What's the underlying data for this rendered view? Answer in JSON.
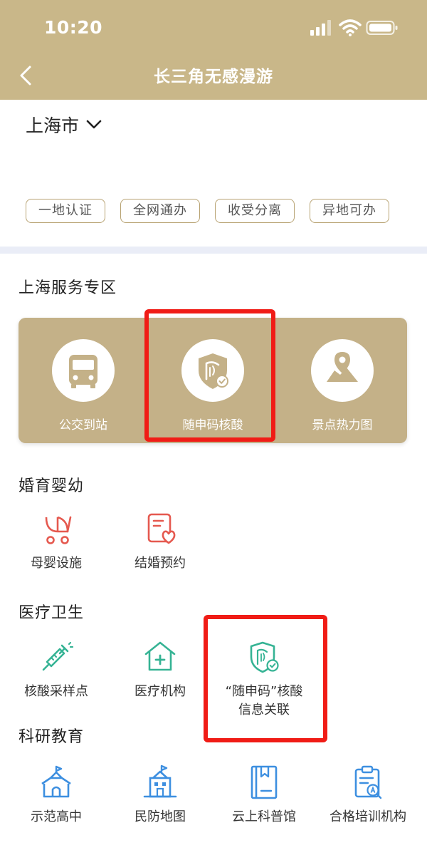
{
  "status": {
    "time": "10:20"
  },
  "header": {
    "title": "长三角无感漫游"
  },
  "city": {
    "name": "上海市"
  },
  "tags": [
    "一地认证",
    "全网通办",
    "收受分离",
    "异地可办"
  ],
  "sections": {
    "shanghai": {
      "title": "上海服务专区",
      "items": [
        {
          "label": "公交到站",
          "icon": "bus-icon"
        },
        {
          "label": "随申码核酸",
          "icon": "shield-check-icon"
        },
        {
          "label": "景点热力图",
          "icon": "map-pin-icon"
        }
      ]
    },
    "marriage": {
      "title": "婚育婴幼",
      "items": [
        {
          "label": "母婴设施",
          "icon": "stroller-icon"
        },
        {
          "label": "结婚预约",
          "icon": "heart-document-icon"
        }
      ]
    },
    "medical": {
      "title": "医疗卫生",
      "items": [
        {
          "label": "核酸采样点",
          "icon": "syringe-icon"
        },
        {
          "label": "医疗机构",
          "icon": "hospital-icon"
        },
        {
          "label": "“随申码”核酸",
          "label2": "信息关联",
          "icon": "shield-check-icon"
        }
      ]
    },
    "education": {
      "title": "科研教育",
      "items": [
        {
          "label": "示范高中",
          "icon": "school-icon"
        },
        {
          "label": "民防地图",
          "icon": "civil-defense-icon"
        },
        {
          "label": "云上科普馆",
          "icon": "book-icon"
        },
        {
          "label": "合格培训机构",
          "icon": "clipboard-icon"
        }
      ]
    }
  },
  "colors": {
    "header": "#c9b789",
    "card": "#c4b188",
    "highlight": "#f01c16",
    "coral": "#e5594f",
    "teal": "#35b394",
    "blue": "#3d8fe0"
  }
}
